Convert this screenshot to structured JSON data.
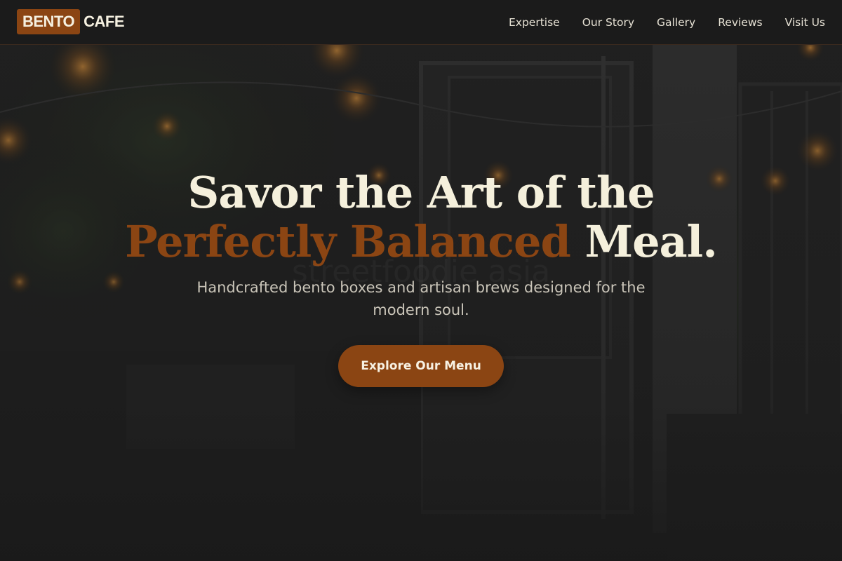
{
  "brand": {
    "logo_box": "BENTO",
    "logo_text": "CAFE"
  },
  "nav": {
    "items": [
      {
        "label": "Expertise"
      },
      {
        "label": "Our Story"
      },
      {
        "label": "Gallery"
      },
      {
        "label": "Reviews"
      },
      {
        "label": "Visit Us"
      }
    ]
  },
  "hero": {
    "title_line1": "Savor the Art of the",
    "title_accent": "Perfectly Balanced",
    "title_end": "Meal.",
    "subtitle": "Handcrafted bento boxes and artisan brews designed for the modern soul.",
    "cta_label": "Explore Our Menu",
    "background_watermark": "streetfoodie asia"
  },
  "colors": {
    "accent": "#8b4513",
    "heading": "#f5f0dc",
    "header_bg": "#1b1b1b",
    "page_bg": "#1c1c1c"
  }
}
